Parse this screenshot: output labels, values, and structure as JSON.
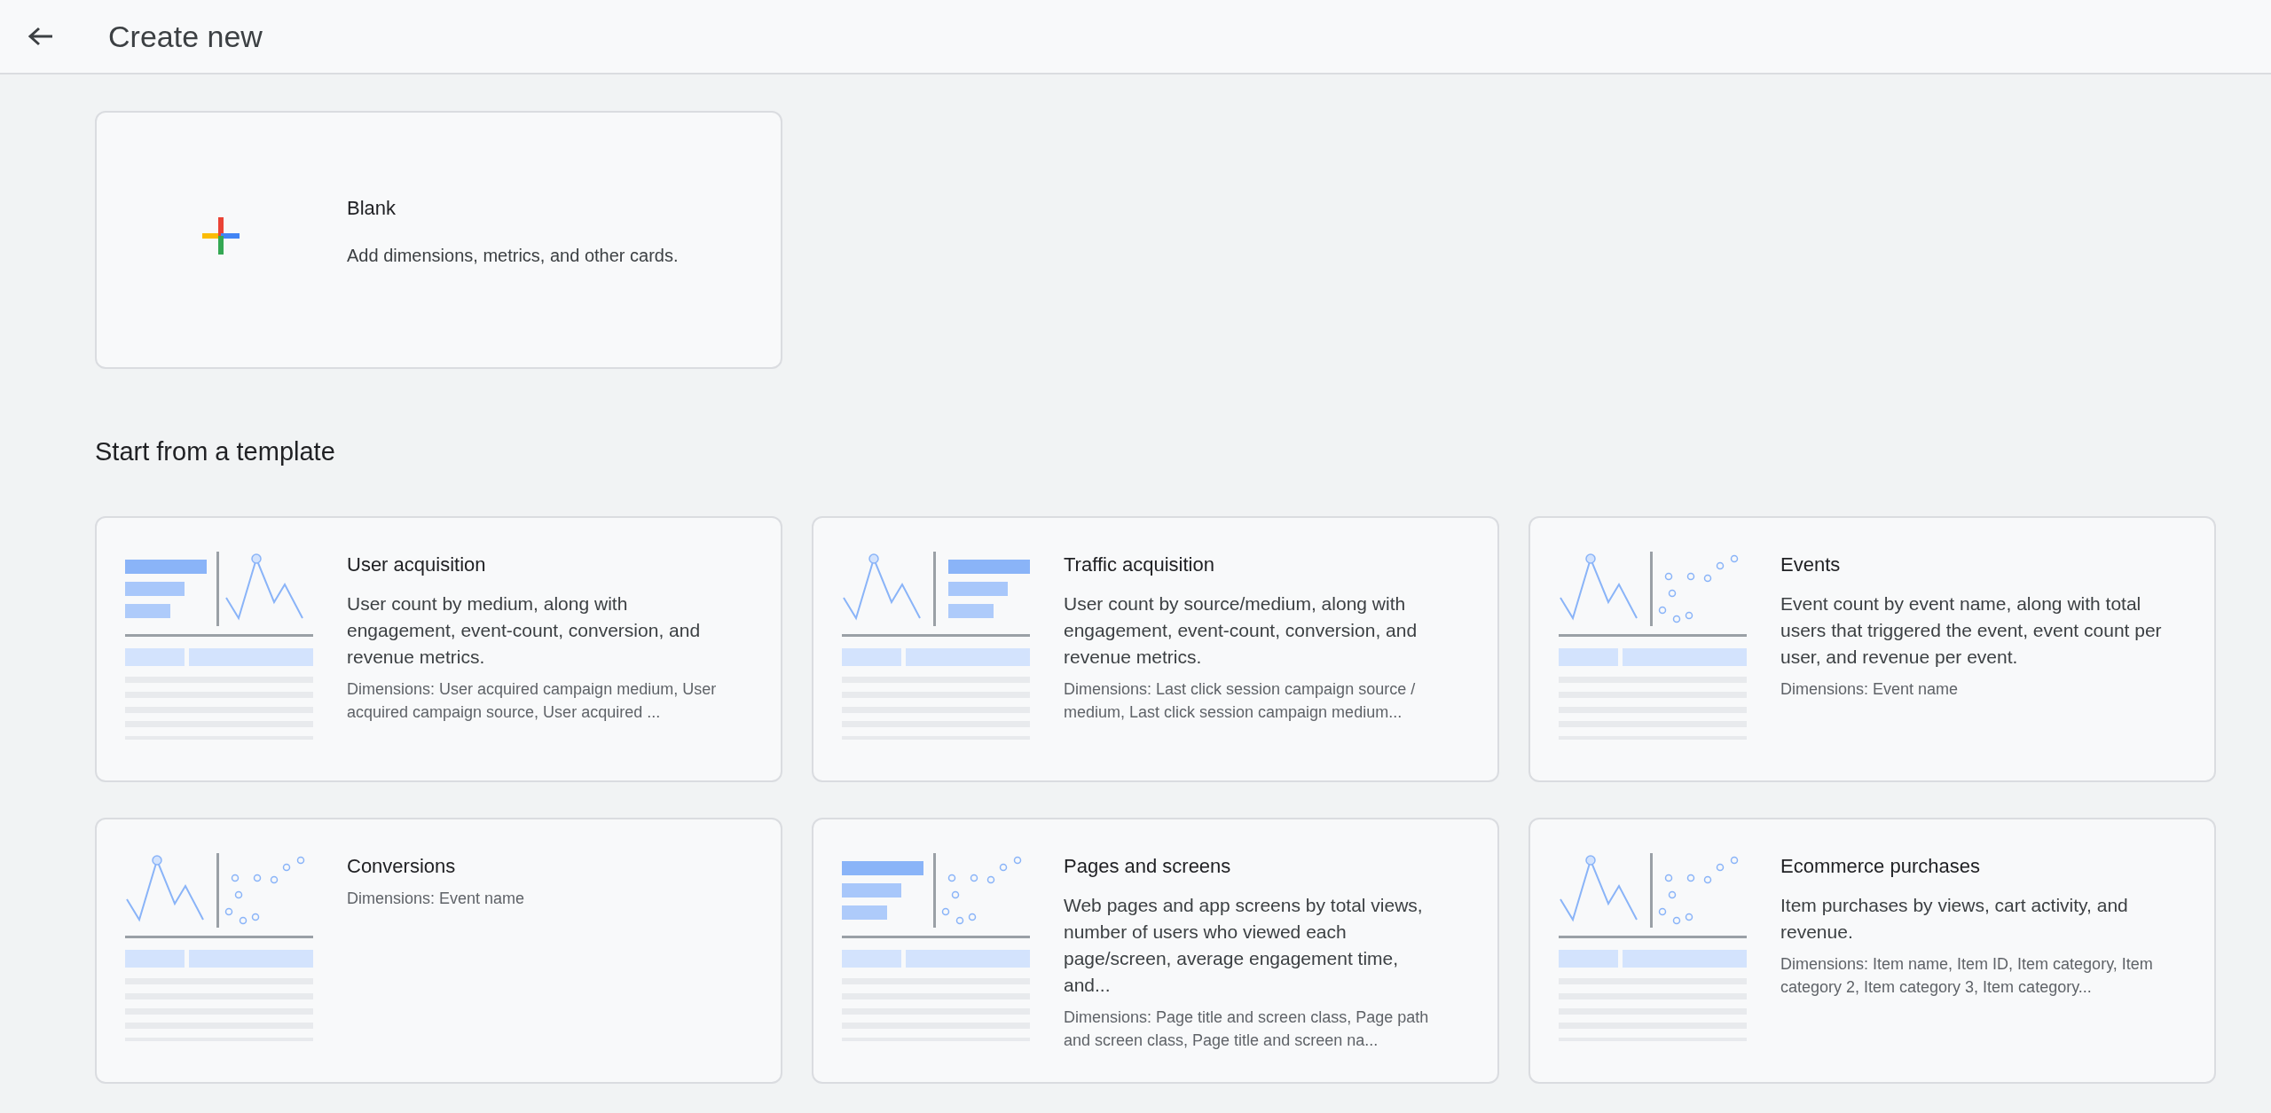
{
  "header": {
    "title": "Create new"
  },
  "blank_card": {
    "title": "Blank",
    "description": "Add dimensions, metrics, and other cards."
  },
  "templates_heading": "Start from a template",
  "templates": [
    {
      "title": "User acquisition",
      "description": "User count by medium, along with engagement, event-count, conversion, and revenue metrics.",
      "dimensions": "Dimensions: User acquired campaign medium, User acquired campaign source, User acquired ...",
      "panels": [
        {
          "kind": "bars"
        },
        {
          "kind": "line"
        }
      ]
    },
    {
      "title": "Traffic acquisition",
      "description": "User count by source/medium, along with engagement, event-count, conversion, and revenue metrics.",
      "dimensions": "Dimensions: Last click session campaign source / medium, Last click session campaign medium...",
      "panels": [
        {
          "kind": "line"
        },
        {
          "kind": "bars"
        }
      ]
    },
    {
      "title": "Events",
      "description": "Event count by event name, along with total users that triggered the event, event count per user, and revenue per event.",
      "dimensions": "Dimensions: Event name",
      "panels": [
        {
          "kind": "line"
        },
        {
          "kind": "scatter"
        }
      ]
    },
    {
      "title": "Conversions",
      "dimensions": "Dimensions: Event name",
      "panels": [
        {
          "kind": "line"
        },
        {
          "kind": "scatter"
        }
      ]
    },
    {
      "title": "Pages and screens",
      "description": "Web pages and app screens by total views, number of users who viewed each page/screen, average engagement time, and...",
      "dimensions": "Dimensions: Page title and screen class, Page path and screen class, Page title and screen na...",
      "panels": [
        {
          "kind": "bars"
        },
        {
          "kind": "scatter"
        }
      ]
    },
    {
      "title": "Ecommerce purchases",
      "description": "Item purchases by views, cart activity, and revenue.",
      "dimensions": "Dimensions: Item name, Item ID, Item category, Item category 2, Item category 3, Item category...",
      "panels": [
        {
          "kind": "line"
        },
        {
          "kind": "scatter"
        }
      ]
    }
  ]
}
